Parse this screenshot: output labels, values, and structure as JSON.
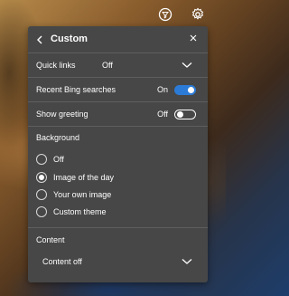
{
  "panel": {
    "title": "Custom",
    "quick_links": {
      "label": "Quick links",
      "value": "Off"
    },
    "recent_bing": {
      "label": "Recent Bing searches",
      "state": "On",
      "enabled": true
    },
    "show_greeting": {
      "label": "Show greeting",
      "state": "Off",
      "enabled": false
    },
    "background": {
      "heading": "Background",
      "options": [
        {
          "label": "Off",
          "selected": false
        },
        {
          "label": "Image of the day",
          "selected": true
        },
        {
          "label": "Your own image",
          "selected": false
        },
        {
          "label": "Custom theme",
          "selected": false
        }
      ]
    },
    "content": {
      "heading": "Content",
      "value": "Content off"
    }
  },
  "colors": {
    "panel": "#474747",
    "accent": "#2b7bd6",
    "divider": "#5e5e5e"
  },
  "icons": [
    "filter-icon",
    "settings-gear-icon",
    "back-chevron-icon",
    "close-icon",
    "chevron-down-icon"
  ]
}
